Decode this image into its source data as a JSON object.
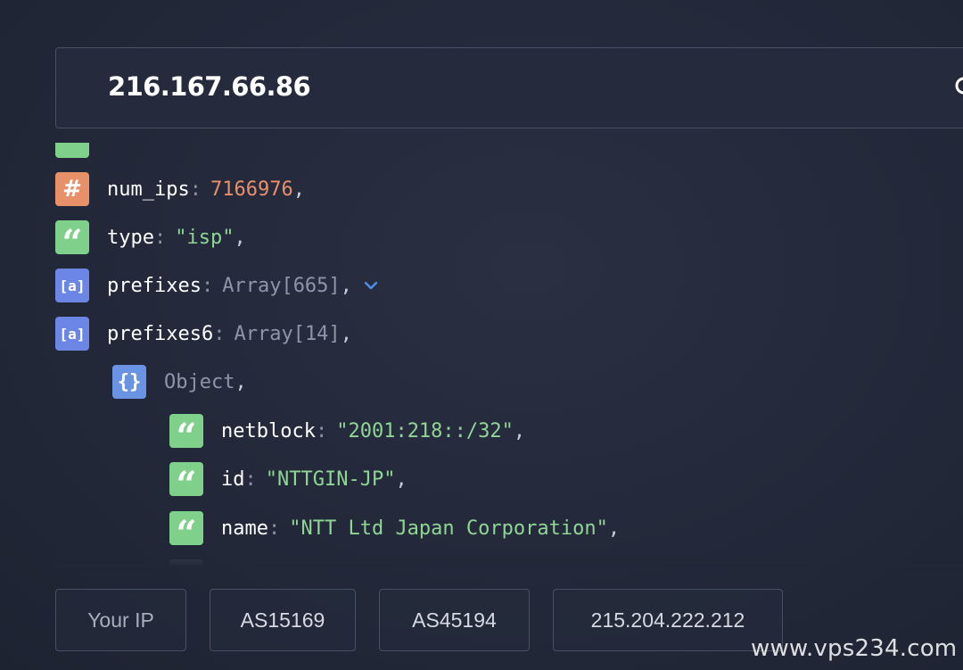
{
  "search": {
    "value": "216.167.66.86"
  },
  "json_viewer": {
    "rows": [
      {
        "badge": "#",
        "key": "num_ips",
        "value": "7166976",
        "comma": ","
      },
      {
        "badge": "“",
        "key": "type",
        "value": "\"isp\"",
        "comma": ","
      },
      {
        "badge": "[a]",
        "key": "prefixes",
        "value": "Array[665]",
        "comma": ","
      },
      {
        "badge": "[a]",
        "key": "prefixes6",
        "value": "Array[14]",
        "comma": ","
      },
      {
        "badge": "{}",
        "value": "Object",
        "comma": ","
      },
      {
        "badge": "“",
        "key": "netblock",
        "value": "\"2001:218::/32\"",
        "comma": ","
      },
      {
        "badge": "“",
        "key": "id",
        "value": "\"NTTGIN-JP\"",
        "comma": ","
      },
      {
        "badge": "“",
        "key": "name",
        "value": "\"NTT Ltd Japan Corporation\"",
        "comma": ","
      }
    ],
    "colon": ":"
  },
  "quick_links": [
    {
      "label": "Your IP"
    },
    {
      "label": "AS15169"
    },
    {
      "label": "AS45194"
    },
    {
      "label": "215.204.222.212"
    }
  ],
  "watermark": "www.vps234.com",
  "colors": {
    "background": "#242a3b",
    "number": "#e8906a",
    "string": "#8fd694",
    "array_badge": "#6b86e4",
    "string_badge": "#7ed08a",
    "number_badge": "#e8906a"
  },
  "icons": {
    "search": "search-icon",
    "expand": "chevron-down-icon"
  }
}
